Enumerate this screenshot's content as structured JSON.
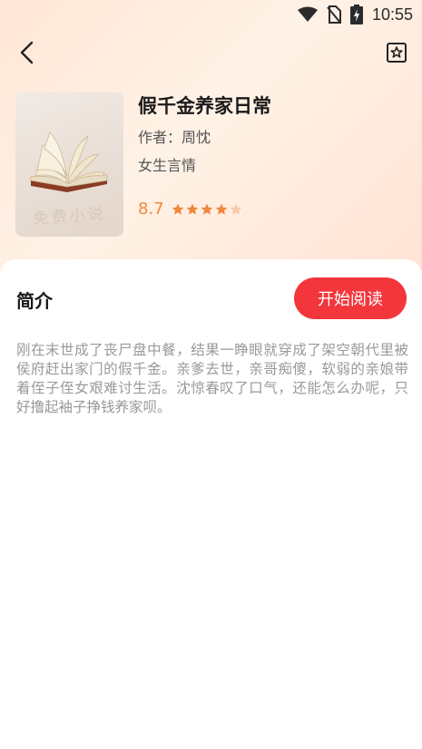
{
  "status_bar": {
    "time": "10:55",
    "icons": [
      "wifi-icon",
      "no-sim-icon",
      "battery-charging-icon"
    ]
  },
  "nav": {
    "back_icon": "chevron-left-icon",
    "bookmark_icon": "bookmark-star-icon"
  },
  "book": {
    "title": "假千金养家日常",
    "author": "作者：周忱",
    "category": "女生言情",
    "rating": "8.7",
    "rating_stars": 4,
    "rating_max": 5,
    "cover_watermark": "免费小说"
  },
  "intro_section": {
    "title": "简介",
    "start_button": "开始阅读",
    "text": "刚在末世成了丧尸盘中餐，结果一睁眼就穿成了架空朝代里被侯府赶出家门的假千金。亲爹去世，亲哥痴傻，软弱的亲娘带着侄子侄女艰难讨生活。沈惊春叹了口气，还能怎么办呢，只好撸起袖子挣钱养家呗。"
  },
  "colors": {
    "accent_red": "#f2363c",
    "rating_orange": "#f0873e",
    "star_empty": "#f7c9a6"
  }
}
